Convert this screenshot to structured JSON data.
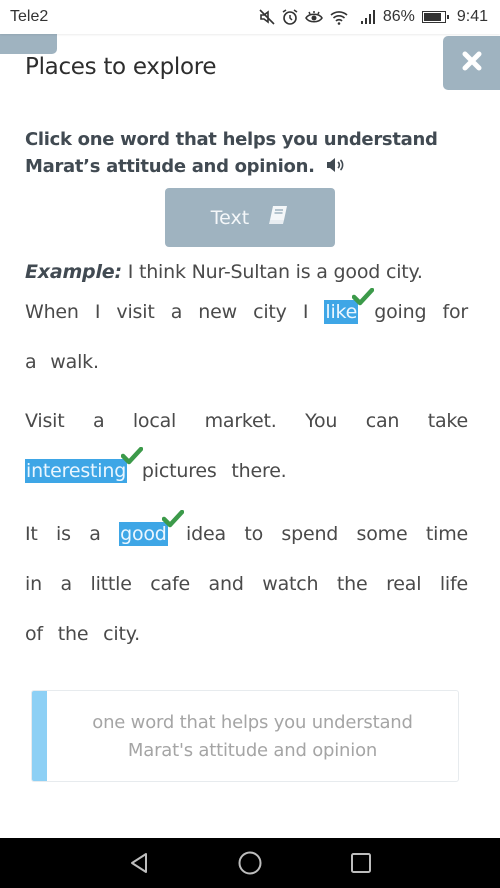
{
  "status_bar": {
    "carrier": "Tele2",
    "icons": [
      "mute-icon",
      "alarm-icon",
      "eye-comfort-icon",
      "wifi-icon",
      "signal-icon"
    ],
    "battery_percent": "86%",
    "battery_level": 0.86,
    "time": "9:41"
  },
  "header": {
    "title": "Places to explore",
    "close_icon": "close-icon"
  },
  "task": {
    "instruction": "Click one word that helps you understand Marat’s attitude and opinion.",
    "audio_icon": "speaker-icon"
  },
  "text_button": {
    "label": "Text",
    "icon": "book-icon"
  },
  "example": {
    "label": "Example:",
    "text": " I think Nur-Sultan is a good city."
  },
  "paragraphs": [
    {
      "before": "When I visit a new city I ",
      "selected": "like",
      "after": " going for a walk."
    },
    {
      "before": "Visit a local market. You can take ",
      "selected": "interesting",
      "after": " pictures there."
    },
    {
      "before": "It is a ",
      "selected": "good",
      "after": " idea to spend some time in a little cafe and watch the real life of the city."
    }
  ],
  "answer_hint": {
    "line1": "one word that helps you understand",
    "line2": "Marat's attitude and opinion"
  },
  "colors": {
    "accent_gray_blue": "#9fb3c0",
    "selection_blue": "#3ea6e6",
    "check_green": "#3c9a4a",
    "answer_bar": "#8dd0f5"
  },
  "nav_bar": {
    "back": "back-icon",
    "home": "home-icon",
    "recents": "recents-icon"
  }
}
